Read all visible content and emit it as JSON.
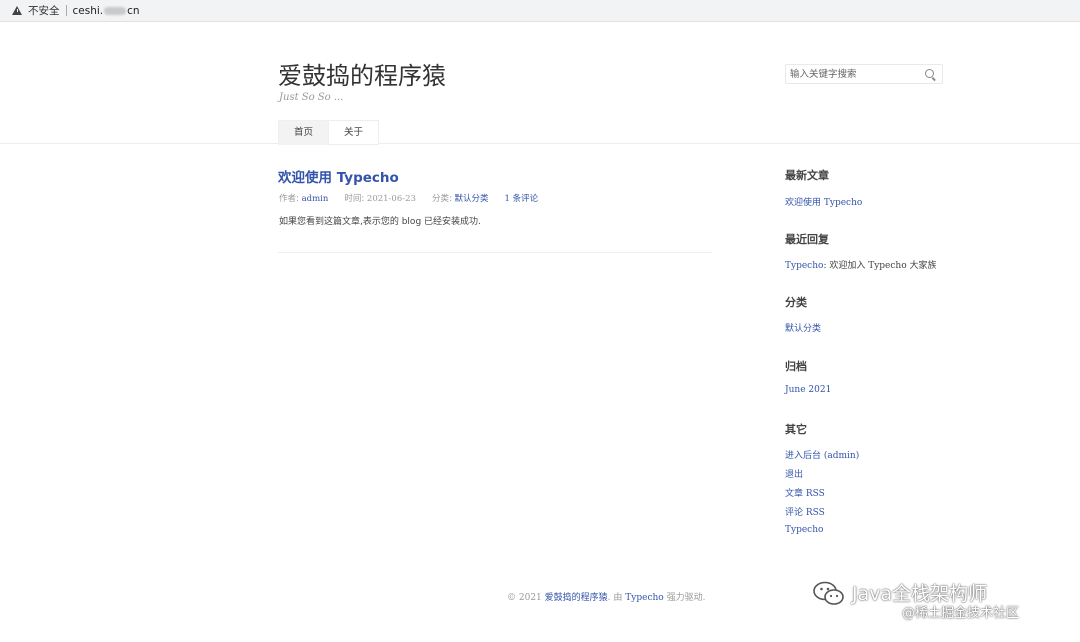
{
  "browser": {
    "security_label": "不安全",
    "url_prefix": "ceshi.",
    "url_suffix": "cn"
  },
  "header": {
    "site_title": "爱鼓捣的程序猿",
    "site_description": "Just So So ...",
    "search_placeholder": "输入关键字搜索"
  },
  "nav": {
    "items": [
      {
        "label": "首页",
        "active": true
      },
      {
        "label": "关于",
        "active": false
      }
    ]
  },
  "post": {
    "title": "欢迎使用 Typecho",
    "author_label": "作者:",
    "author": "admin",
    "time_label": "时间:",
    "time": "2021-06-23",
    "category_label": "分类:",
    "category": "默认分类",
    "comments": "1 条评论",
    "excerpt": "如果您看到这篇文章,表示您的 blog 已经安装成功."
  },
  "sidebar": {
    "recent_posts": {
      "title": "最新文章",
      "items": [
        "欢迎使用 Typecho"
      ]
    },
    "recent_comments": {
      "title": "最近回复",
      "author": "Typecho",
      "text": ": 欢迎加入 Typecho 大家族"
    },
    "categories": {
      "title": "分类",
      "items": [
        "默认分类"
      ]
    },
    "archives": {
      "title": "归档",
      "items": [
        "June 2021"
      ]
    },
    "others": {
      "title": "其它",
      "items": [
        "进入后台 (admin)",
        "退出",
        "文章 RSS",
        "评论 RSS",
        "Typecho"
      ]
    }
  },
  "footer": {
    "copyright": "© 2021",
    "site_link": "爱鼓捣的程序猿",
    "by": ". 由",
    "engine_link": "Typecho",
    "powered": "强力驱动."
  },
  "watermark": {
    "main": "Java全栈架构师",
    "sub": "@稀土掘金技术社区"
  }
}
